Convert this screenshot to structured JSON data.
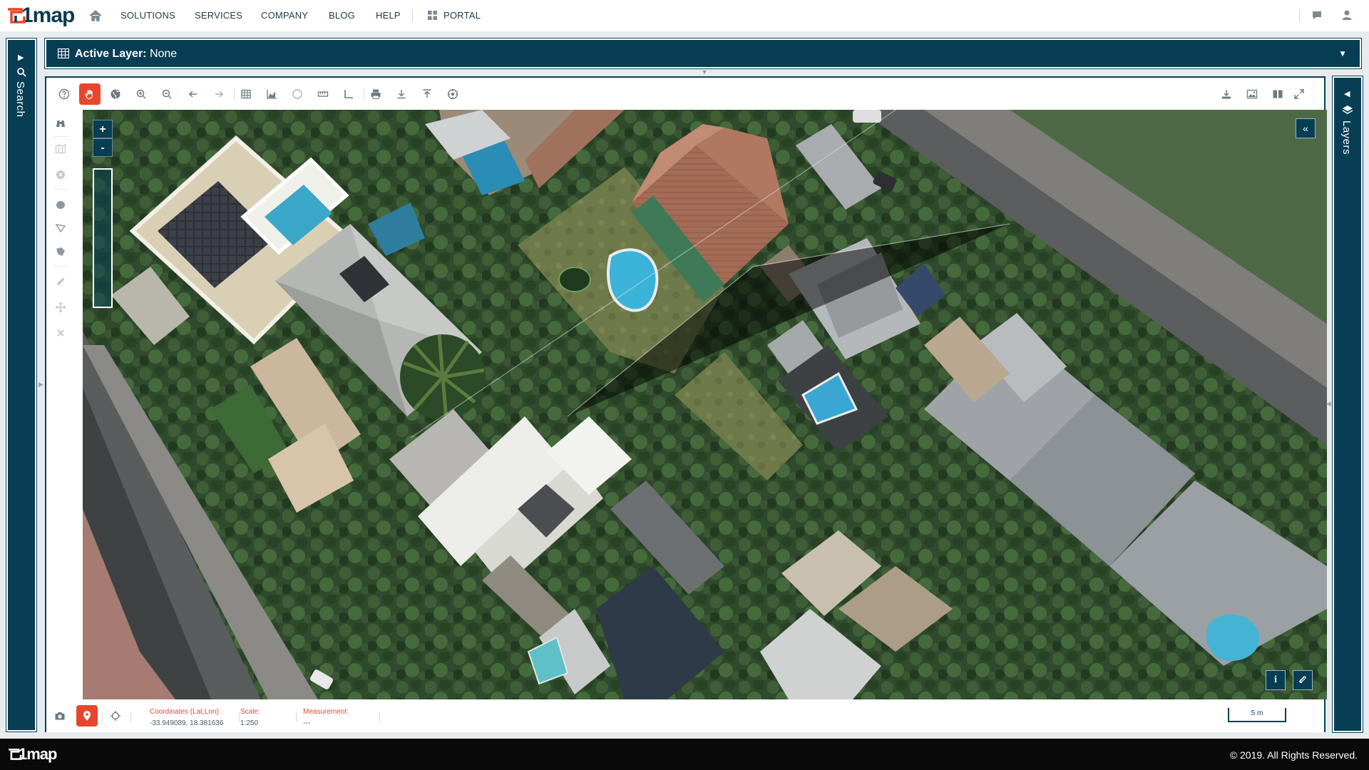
{
  "nav": {
    "logo_text": "1map",
    "items": [
      "SOLUTIONS",
      "SERVICES",
      "COMPANY",
      "BLOG",
      "HELP"
    ],
    "portal": "PORTAL"
  },
  "search_panel": {
    "label": "Search"
  },
  "layers_panel": {
    "label": "Layers"
  },
  "active_layer": {
    "label": "Active Layer:",
    "value": "None"
  },
  "zoom": {
    "plus": "+",
    "minus": "-"
  },
  "status": {
    "coordinates_label": "Coordinates (Lat,Lon):",
    "coordinates_value": "-33.949089, 18.381636",
    "scale_label": "Scale:",
    "scale_value": "1:250",
    "measurement_label": "Measurement:",
    "measurement_value": "---",
    "scale_bar": "5 m"
  },
  "map_buttons": {
    "collapse": "«",
    "info": "i"
  },
  "footer": {
    "logo_text": "1map",
    "copyright": "© 2019. All Rights Reserved."
  },
  "colors": {
    "brand_dark": "#083e54",
    "accent": "#e8462c"
  },
  "toolbar_icons": [
    "help-icon",
    "pan-hand-icon",
    "globe-icon",
    "zoom-in-icon",
    "zoom-out-icon",
    "back-arrow-icon",
    "forward-arrow-icon",
    "table-icon",
    "chart-icon",
    "circle-icon",
    "ruler-icon",
    "angle-icon",
    "print-icon",
    "download-icon",
    "upload-icon",
    "settings-icon"
  ]
}
